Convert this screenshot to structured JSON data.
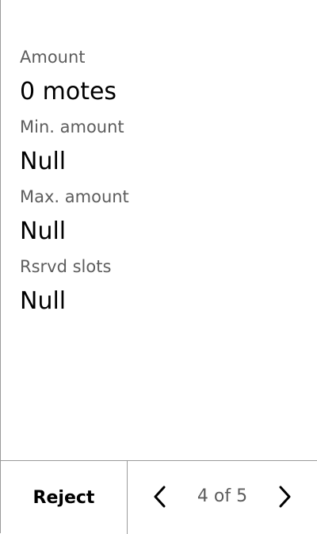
{
  "fields": [
    {
      "label": "Amount",
      "value": "0 motes"
    },
    {
      "label": "Min. amount",
      "value": "Null"
    },
    {
      "label": "Max. amount",
      "value": "Null"
    },
    {
      "label": "Rsrvd slots",
      "value": "Null"
    }
  ],
  "footer": {
    "reject_label": "Reject",
    "page_indicator": "4 of 5",
    "prev_icon": "chevron-left-icon",
    "next_icon": "chevron-right-icon"
  },
  "colors": {
    "label": "#5d5d5d",
    "value": "#000000",
    "divider": "#9a9a9a"
  }
}
